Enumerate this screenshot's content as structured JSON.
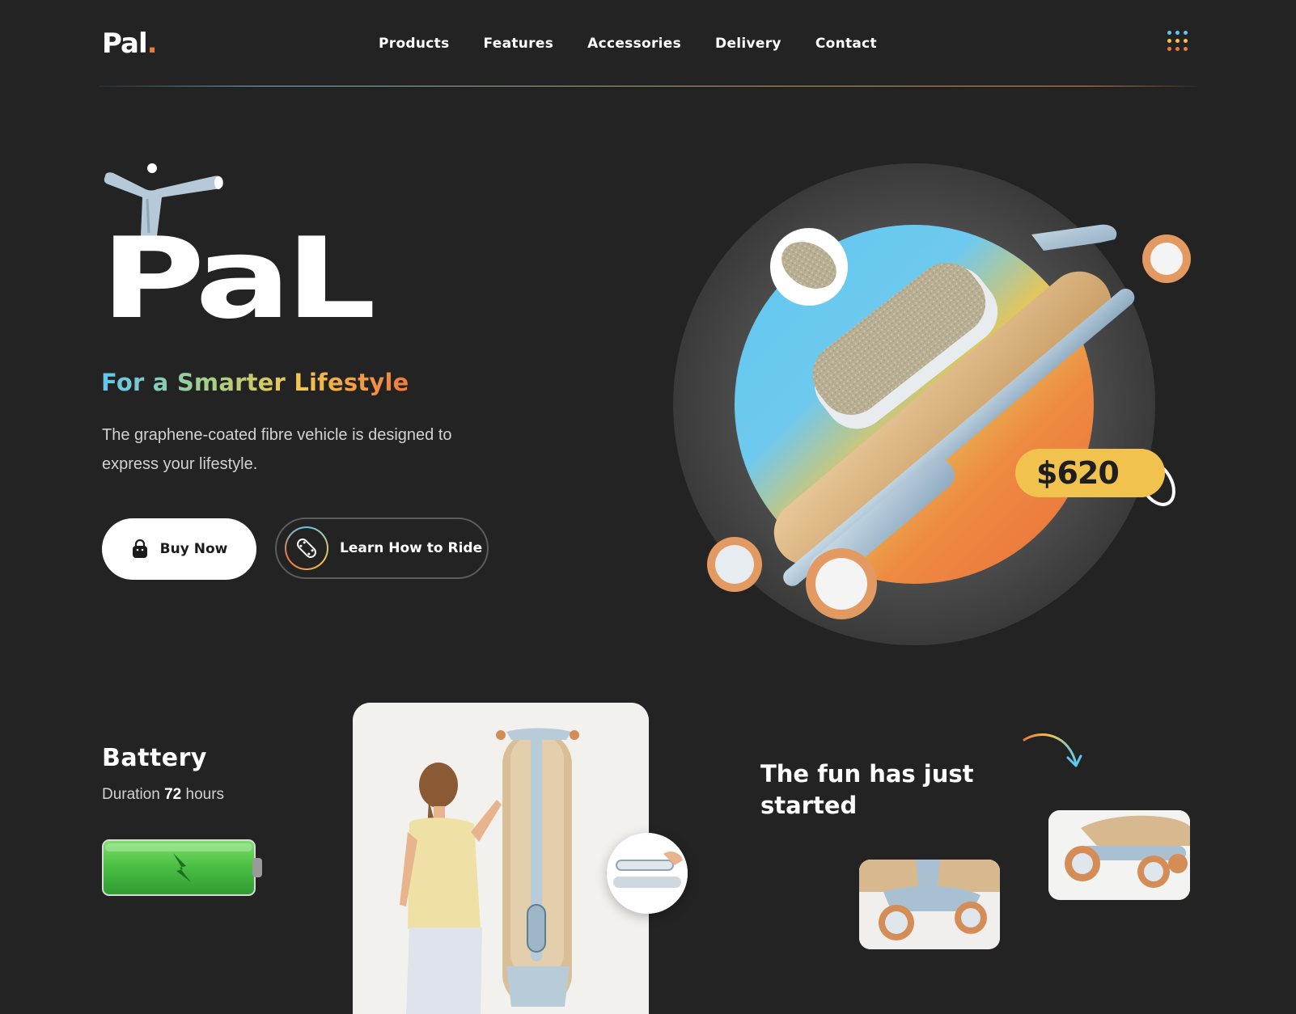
{
  "brand": {
    "logo_text": "Pal",
    "logo_dot": ".",
    "accent_orange": "#f07a3e",
    "accent_blue": "#5fc8f0",
    "accent_yellow": "#f2c24e",
    "background": "#232323"
  },
  "nav": {
    "items": [
      {
        "label": "Products"
      },
      {
        "label": "Features"
      },
      {
        "label": "Accessories"
      },
      {
        "label": "Delivery"
      },
      {
        "label": "Contact"
      }
    ],
    "menu_icon": "grid-dots-icon"
  },
  "hero": {
    "title": "PaL",
    "tagline": "For a Smarter Lifestyle",
    "description": "The graphene-coated fibre vehicle is designed to express your lifestyle.",
    "buy_button": {
      "label": "Buy Now",
      "icon": "shopping-bag-icon"
    },
    "learn_button": {
      "label": "Learn How to Ride",
      "icon": "skateboard-icon"
    },
    "price": "$620"
  },
  "battery": {
    "title": "Battery",
    "duration_prefix": "Duration ",
    "duration_value": "72",
    "duration_suffix": " hours",
    "icon": "lightning-icon",
    "color": "#4cc145"
  },
  "fun": {
    "title": "The fun has just started",
    "arrow_icon": "curved-arrow-icon"
  }
}
